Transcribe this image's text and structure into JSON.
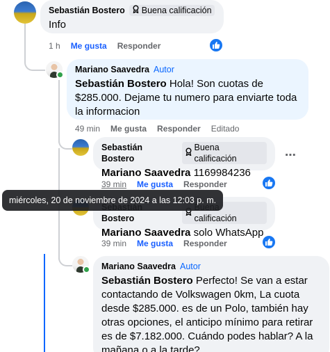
{
  "colors": {
    "accent": "#0866ff",
    "like_text": "#1a60ff",
    "bubble": "#f0f2f5",
    "bubble_highlight": "#ebf5ff",
    "meta": "#65676b",
    "online": "#31a24c"
  },
  "labels": {
    "like": "Me gusta",
    "reply": "Responder",
    "edited": "Editado",
    "author_tag": "Autor",
    "badge": "Buena calificación"
  },
  "comments": [
    {
      "author": "Sebastián Bostero",
      "badge": "Buena calificación",
      "text": "Info",
      "time": "1 h",
      "avatar": "landscape-avatar"
    },
    {
      "author": "Mariano Saavedra",
      "author_tag": "Autor",
      "mention": "Sebastián Bostero",
      "text": " Hola! Son cuotas de $285.000. Dejame tu numero para enviarte toda la informacion",
      "time": "49 min",
      "edited": "Editado",
      "avatar": "person-avatar"
    },
    {
      "author": "Sebastián Bostero",
      "badge": "Buena calificación",
      "mention": "Mariano Saavedra",
      "text": " 1169984236",
      "time": "39 min",
      "avatar": "landscape-avatar"
    },
    {
      "author": "Sebastián Bostero",
      "badge": "Buena calificación",
      "mention": "Mariano Saavedra",
      "text": " solo WhatsApp",
      "time": "39 min",
      "avatar": "landscape-avatar"
    },
    {
      "author": "Mariano Saavedra",
      "author_tag": "Autor",
      "mention": "Sebastián Bostero",
      "text": " Perfecto! Se van a estar contactando de Volkswagen 0km, La cuota desde $285.000. es de un Polo, también hay otras opciones, el anticipo mínimo para retirar es de $7.182.000. Cuándo podes hablar? A la mañana o a la tarde?",
      "avatar": "person-avatar"
    }
  ],
  "tooltip": {
    "text": "miércoles, 20 de noviembre de 2024 a las 12:03 p. m."
  },
  "icons": {
    "like_reaction": "thumbs-up-icon",
    "badge": "badge-icon",
    "more": "more-options-icon"
  }
}
